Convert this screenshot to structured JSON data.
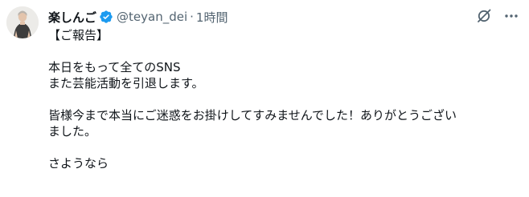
{
  "tweet": {
    "display_name": "楽しんご",
    "handle": "@teyan_dei",
    "separator": "·",
    "time": "1時間",
    "lines": [
      "【ご報告】",
      "",
      "本日をもって全てのSNS",
      "また芸能活動を引退します。",
      "",
      "皆様今まで本当にご迷惑をお掛けしてすみませんでした！ありがとうござい",
      "ました。",
      "",
      "さようなら"
    ]
  },
  "icons": {
    "verified": "verified-badge-icon",
    "grok": "grok-icon",
    "more": "more-icon"
  },
  "colors": {
    "text": "#0f1419",
    "secondary": "#536471",
    "verified": "#1d9bf0"
  }
}
